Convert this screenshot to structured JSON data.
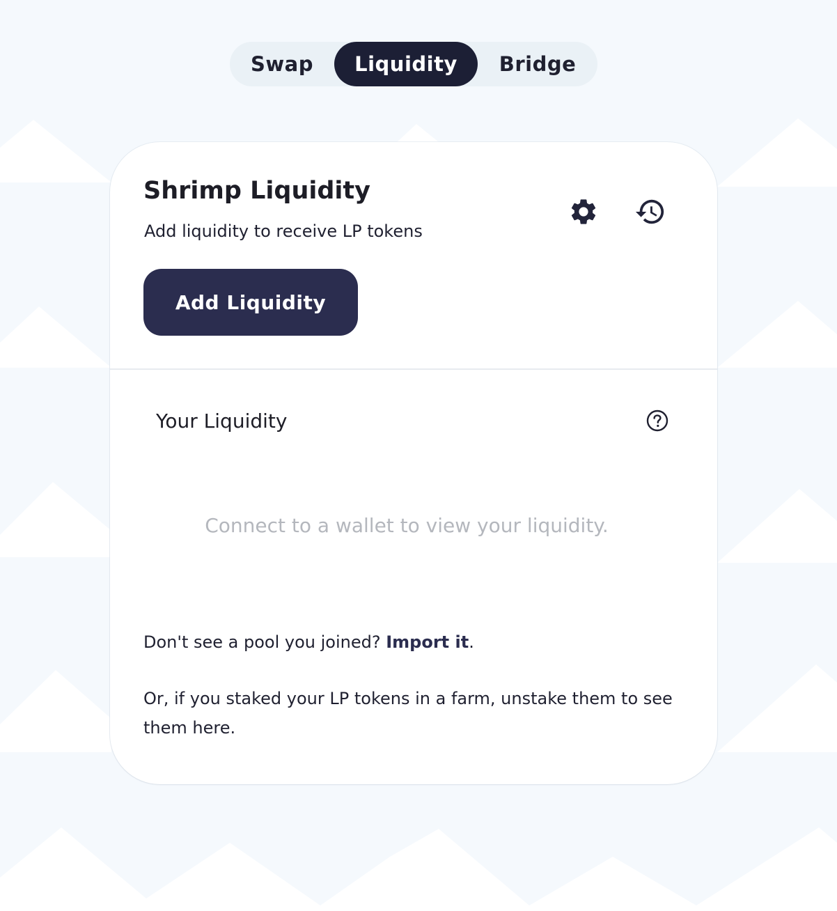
{
  "nav": {
    "tabs": [
      {
        "label": "Swap",
        "active": false
      },
      {
        "label": "Liquidity",
        "active": true
      },
      {
        "label": "Bridge",
        "active": false
      }
    ]
  },
  "card": {
    "title": "Shrimp Liquidity",
    "subtitle": "Add liquidity to receive LP tokens",
    "settings_icon": "gear-icon",
    "history_icon": "history-icon",
    "add_button_label": "Add Liquidity"
  },
  "your_liquidity": {
    "title": "Your Liquidity",
    "help_icon": "question-circle-icon",
    "empty_message": "Connect to a wallet to view your liquidity."
  },
  "footer": {
    "import_prefix": "Don't see a pool you joined? ",
    "import_link": "Import it",
    "import_suffix": ".",
    "unstake_text": "Or, if you staked your LP tokens in a farm, unstake them to see them here."
  },
  "colors": {
    "background": "#f5f9fd",
    "primary": "#2b2d4f",
    "active_tab": "#1c1f35",
    "muted_text": "#b4b7bd"
  }
}
